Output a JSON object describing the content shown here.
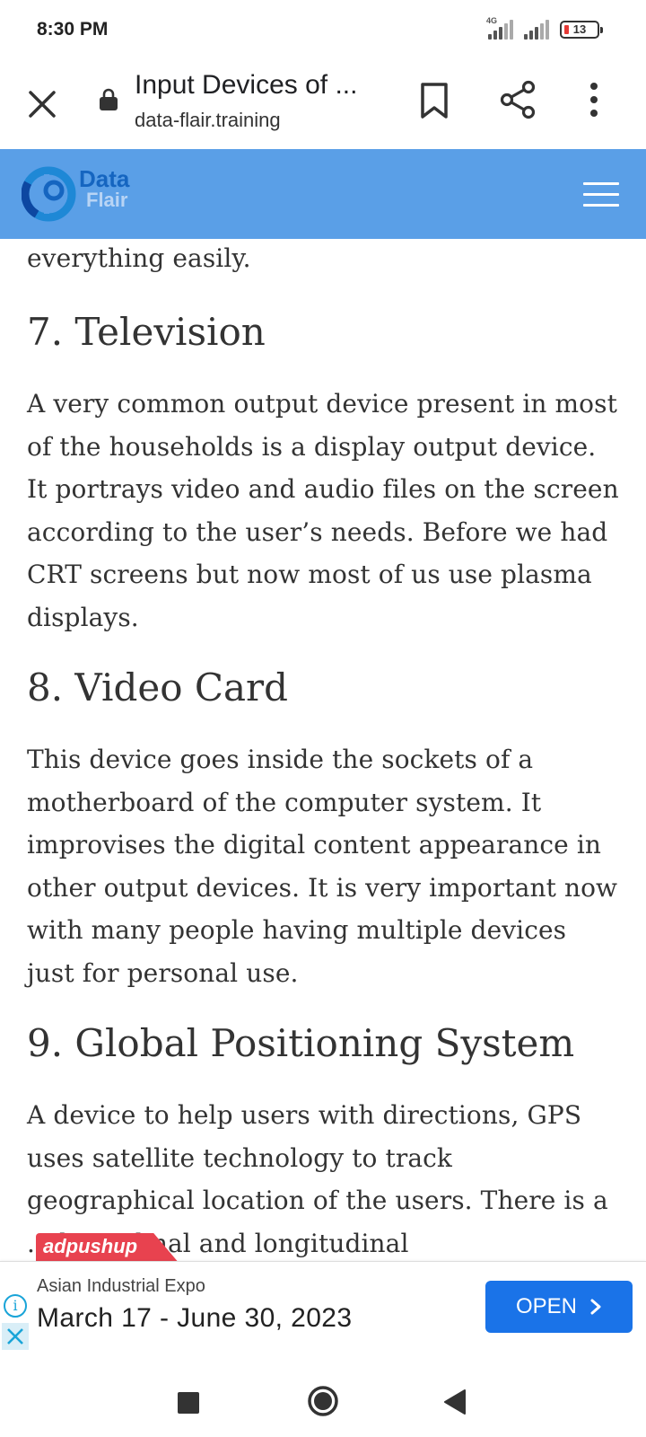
{
  "status_bar": {
    "time": "8:30 PM",
    "network_label": "4G",
    "battery_level": "13",
    "icons": [
      "signal-icon",
      "signal-icon",
      "battery-icon"
    ]
  },
  "toolbar": {
    "page_title": "Input Devices of ...",
    "url": "data-flair.training",
    "icons": [
      "close-icon",
      "lock-icon",
      "bookmark-icon",
      "share-icon",
      "more-vert-icon"
    ]
  },
  "site_header": {
    "logo_line1": "Data",
    "logo_line2": "Flair",
    "brand_color": "#5a9fe7"
  },
  "article": {
    "lead_text": "everything easily.",
    "sections": [
      {
        "heading": "7. Television",
        "body": "A very common output device present in most of the households is a display output device. It portrays video and audio files on the screen according to the user’s needs. Before we had CRT screens but now most of us use plasma displays."
      },
      {
        "heading": "8. Video Card",
        "body": "This device goes inside the sockets of a motherboard of the computer system. It improvises the digital content appearance in other output devices. It is very important now with many people having multiple devices just for personal use."
      },
      {
        "heading": "9. Global Positioning System",
        "body": "A device to help users with directions, GPS uses satellite technology to track geographical location of the users. There is a ... latitudinal and longitudinal"
      }
    ]
  },
  "ad": {
    "network": "adpushup",
    "advertiser": "Asian Industrial Expo",
    "headline": "March 17 - June 30, 2023",
    "cta_label": "OPEN",
    "cta_color": "#1a73e8"
  },
  "nav_bar": {
    "icons": [
      "recents-icon",
      "home-icon",
      "back-icon"
    ]
  }
}
